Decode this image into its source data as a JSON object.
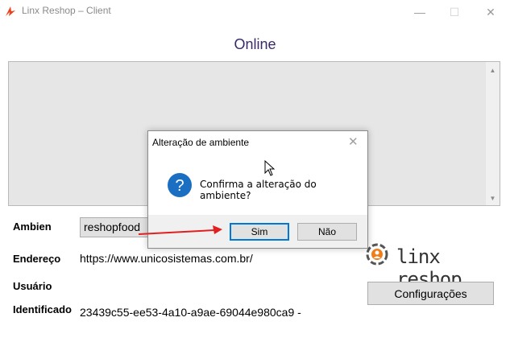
{
  "window": {
    "title": "Linx Reshop – Client",
    "controls": {
      "minimize": "—",
      "maximize": "☐",
      "close": "✕"
    }
  },
  "status": {
    "text": "Online"
  },
  "form": {
    "ambiente_label": "Ambien",
    "ambiente_value": "reshopfood",
    "endereco_label": "Endereço",
    "endereco_value": "https://www.unicosistemas.com.br/",
    "usuario_label": "Usuário",
    "identificador_label": "Identificado",
    "identificador_value": "23439c55-ee53-4a10-a9ae-69044e980ca9 -"
  },
  "logo": {
    "text": "linx reshop",
    "icon": "linx-gear-logo-icon"
  },
  "buttons": {
    "configuracoes": "Configurações"
  },
  "dialog": {
    "title": "Alteração de ambiente",
    "message": "Confirma a alteração do ambiente?",
    "icon": "question-icon",
    "yes": "Sim",
    "no": "Não"
  },
  "colors": {
    "status": "#3a2a6a",
    "accent": "#0078d7",
    "arrow": "#e02020",
    "logo_orange": "#f07d1a"
  }
}
